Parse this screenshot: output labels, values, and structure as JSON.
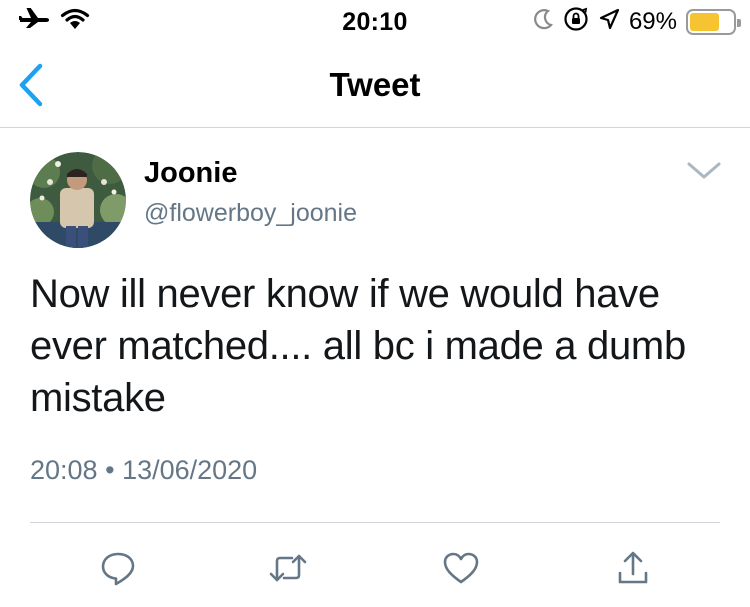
{
  "status_bar": {
    "time": "20:10",
    "battery_percent": "69%",
    "battery_level": 0.69,
    "icons": [
      "airplane-icon",
      "wifi-icon",
      "moon-icon",
      "orientation-lock-icon",
      "location-icon",
      "battery-icon"
    ]
  },
  "nav": {
    "title": "Tweet",
    "back_icon": "chevron-left-icon"
  },
  "tweet": {
    "user": {
      "name": "Joonie",
      "handle": "@flowerboy_joonie"
    },
    "text": "Now ill never know if we would have ever matched.... all bc i made a dumb mistake",
    "time": "20:08",
    "separator": "•",
    "date": "13/06/2020"
  },
  "actions": [
    {
      "name": "reply",
      "icon": "reply-icon"
    },
    {
      "name": "retweet",
      "icon": "retweet-icon"
    },
    {
      "name": "like",
      "icon": "heart-icon"
    },
    {
      "name": "share",
      "icon": "share-icon"
    }
  ],
  "colors": {
    "accent": "#1da1f2",
    "secondary_text": "#657786",
    "divider": "#cfd5da",
    "battery": "#f7c431"
  }
}
